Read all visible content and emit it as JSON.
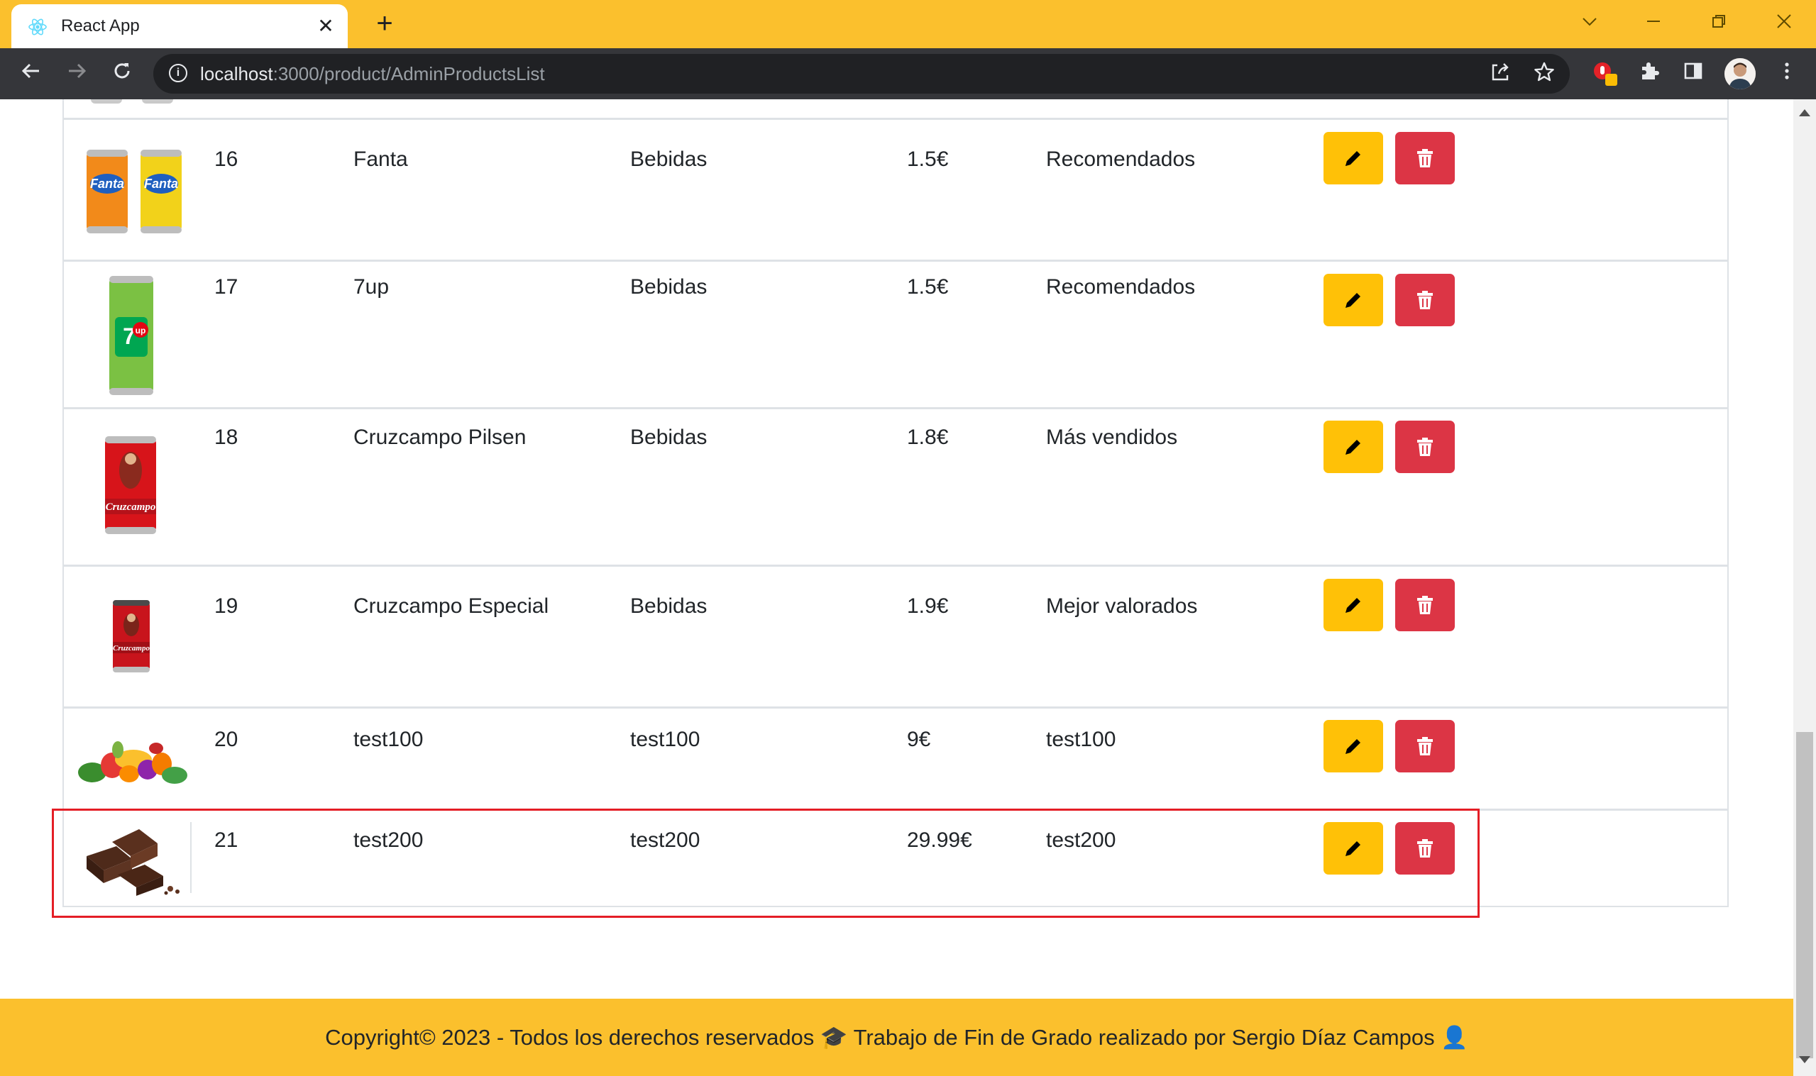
{
  "browser": {
    "tab_title": "React App",
    "tab_close": "✕",
    "new_tab": "+",
    "url_host": "localhost",
    "url_rest": ":3000/product/AdminProductsList",
    "icons": [
      "react-favicon",
      "back-arrow",
      "forward-arrow",
      "reload",
      "info",
      "share",
      "star",
      "extension-adblock",
      "puzzle",
      "side-panel",
      "profile-avatar",
      "kebab-menu",
      "chevron-down",
      "minimize",
      "restore",
      "close"
    ]
  },
  "products": [
    {
      "id": "16",
      "name": "Fanta",
      "category": "Bebidas",
      "price": "1.5€",
      "section": "Recomendados",
      "image": "fanta-cans"
    },
    {
      "id": "17",
      "name": "7up",
      "category": "Bebidas",
      "price": "1.5€",
      "section": "Recomendados",
      "image": "7up-can"
    },
    {
      "id": "18",
      "name": "Cruzcampo Pilsen",
      "category": "Bebidas",
      "price": "1.8€",
      "section": "Más vendidos",
      "image": "cruzcampo-pilsen-can"
    },
    {
      "id": "19",
      "name": "Cruzcampo Especial",
      "category": "Bebidas",
      "price": "1.9€",
      "section": "Mejor valorados",
      "image": "cruzcampo-especial-can"
    },
    {
      "id": "20",
      "name": "test100",
      "category": "test100",
      "price": "9€",
      "section": "test100",
      "image": "fruit-pile"
    },
    {
      "id": "21",
      "name": "test200",
      "category": "test200",
      "price": "29.99€",
      "section": "test200",
      "image": "chocolate-pieces"
    }
  ],
  "colors": {
    "browser_frame": "#fbc02d",
    "edit_button": "#ffc107",
    "delete_button": "#dc3545",
    "highlight_border": "#e41e26",
    "footer": "#fbc02d"
  },
  "footer": {
    "text": "Copyright© 2023 - Todos los derechos reservados 🎓 Trabajo de Fin de Grado realizado por Sergio Díaz Campos 👤"
  }
}
